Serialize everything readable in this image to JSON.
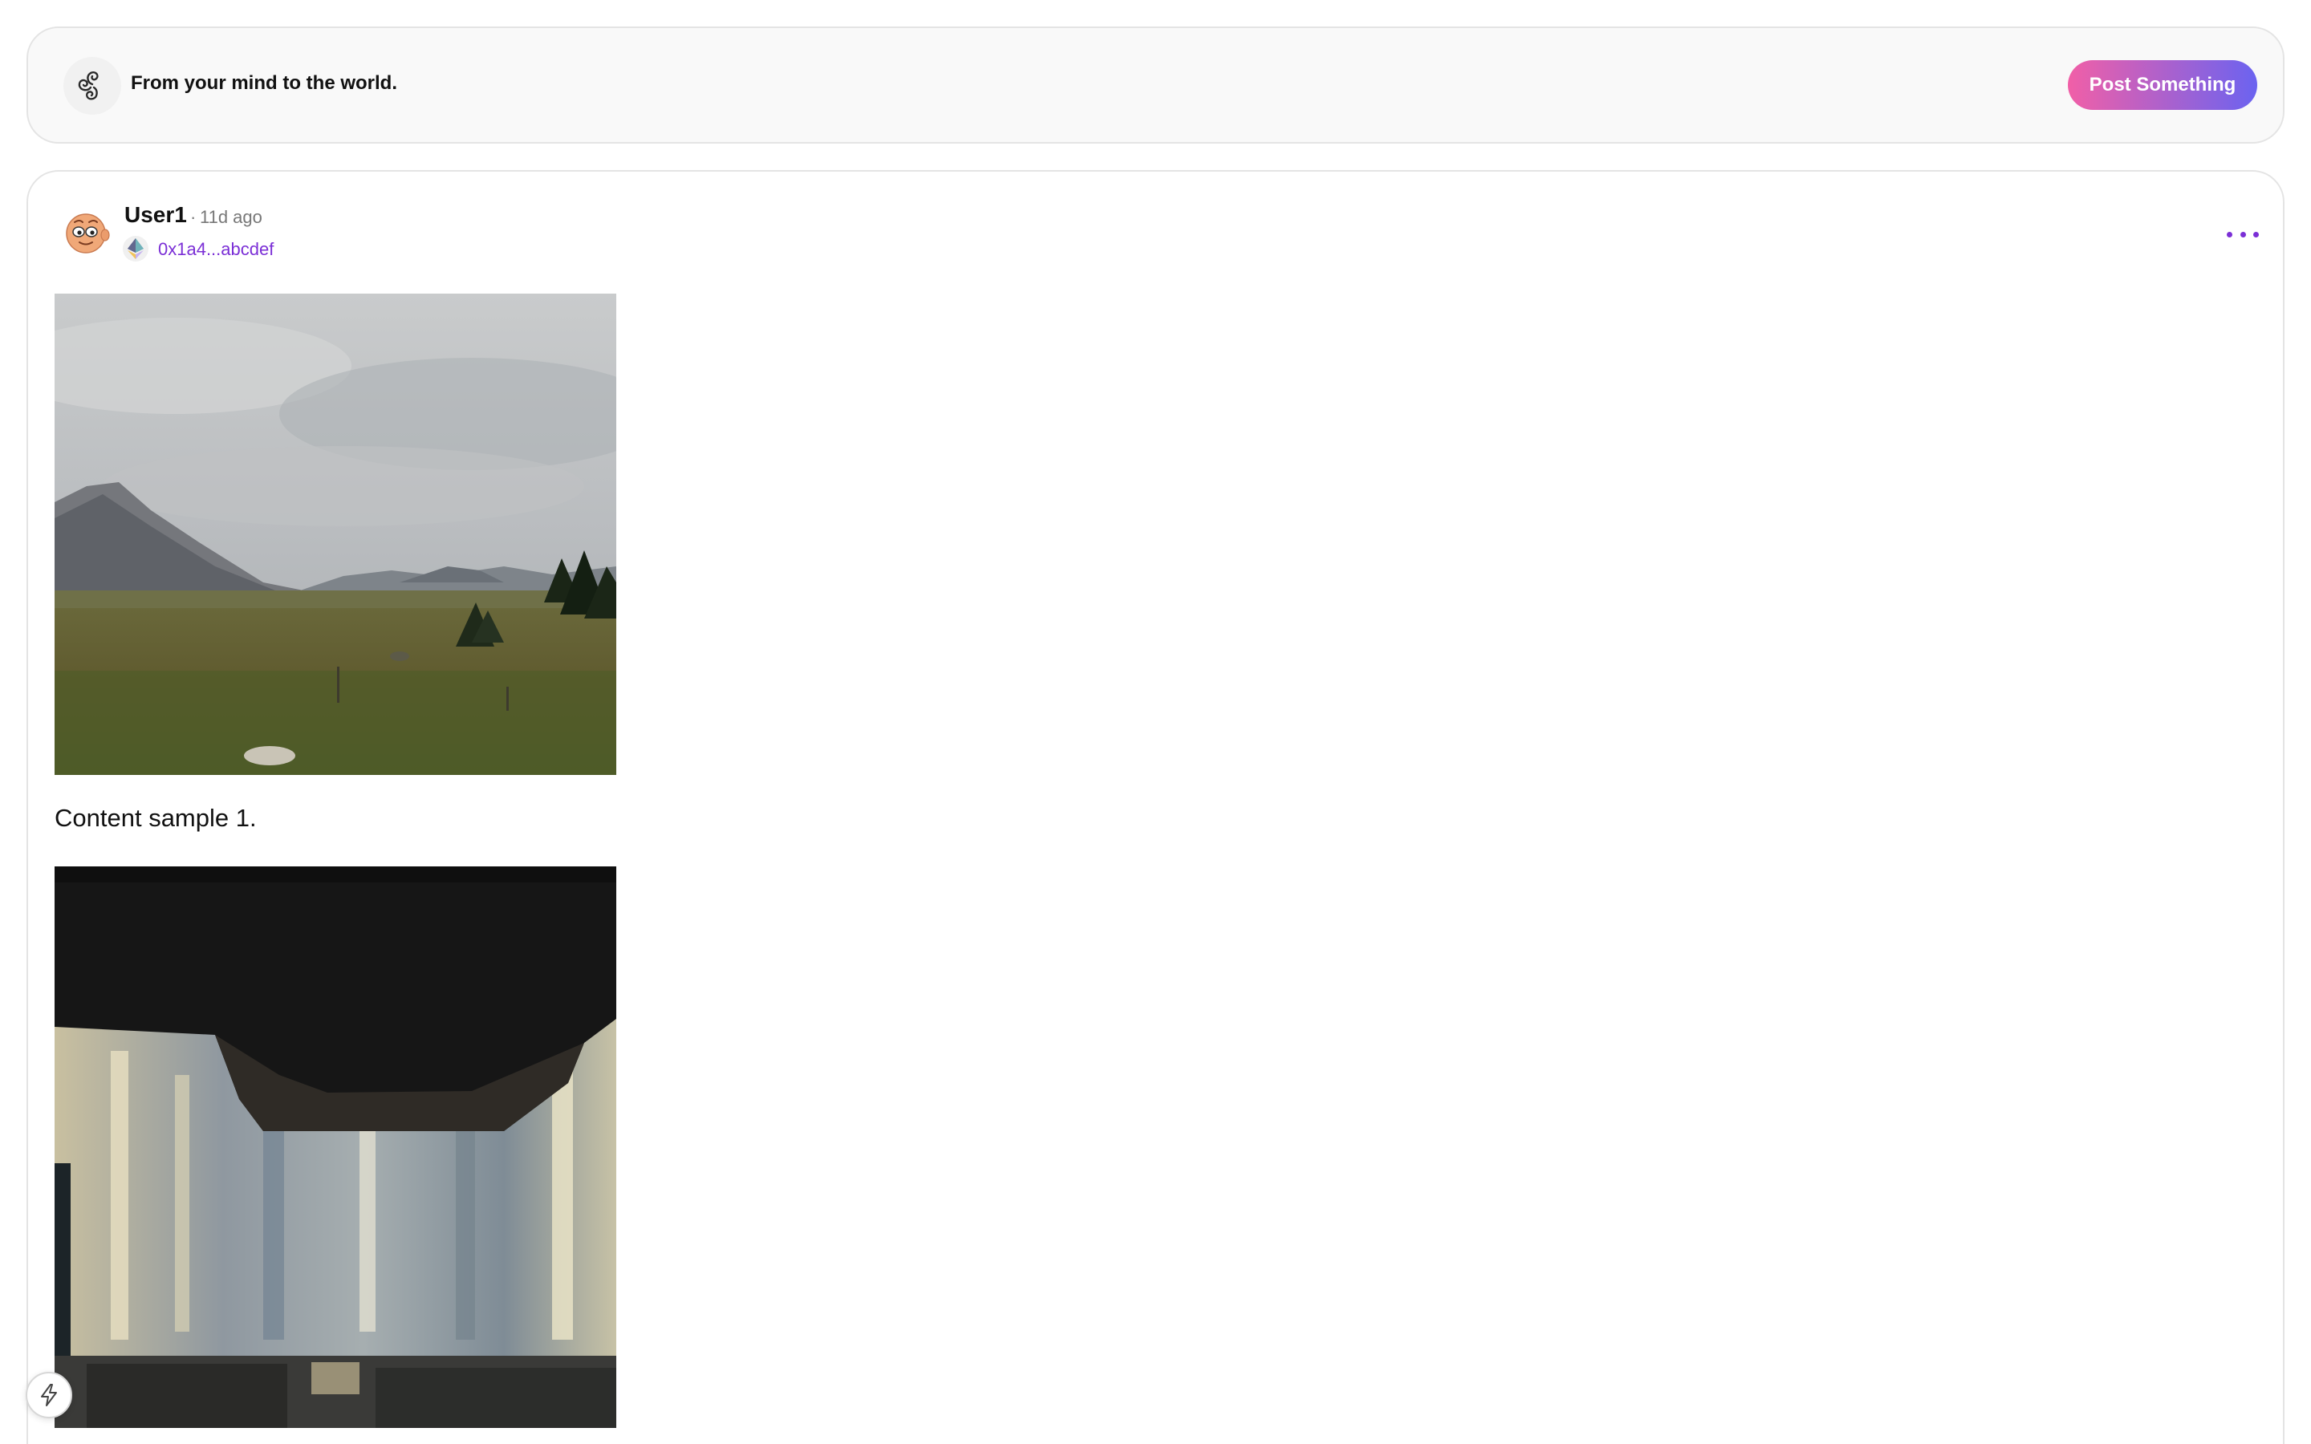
{
  "header": {
    "brand_icon": "triskelion-icon",
    "tagline": "From your mind to the world.",
    "post_button_label": "Post Something",
    "post_button_gradient": [
      "#f15fa7",
      "#6b63f0"
    ]
  },
  "post": {
    "avatar_icon": "cartoon-face-avatar",
    "username": "User1",
    "separator": "·",
    "time_ago": "11d ago",
    "chain_icon": "ethereum-icon",
    "wallet_address": "0x1a4...abcdef",
    "wallet_color": "#7b2fd6",
    "more_icon": "more-horizontal-icon",
    "more_color": "#7b2fd6",
    "images": [
      {
        "icon": "landscape-photo",
        "subject": "mountain meadow under cloudy sky"
      },
      {
        "icon": "interior-photo",
        "subject": "blurred interior with dark ceiling"
      }
    ],
    "content": "Content sample 1."
  },
  "fab": {
    "icon": "lightning-bolt-icon"
  }
}
